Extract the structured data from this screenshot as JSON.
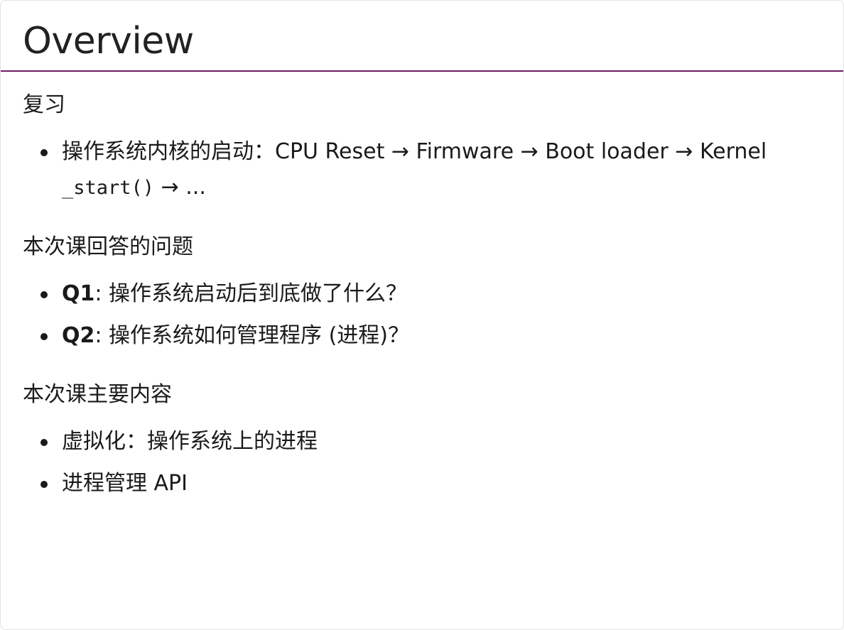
{
  "slide": {
    "title": "Overview",
    "sections": [
      {
        "heading": "复习",
        "items": [
          {
            "text_1": "操作系统内核的启动：CPU Reset → Firmware → Boot loader → Kernel ",
            "code": "_start()",
            "text_2": " → ..."
          }
        ]
      },
      {
        "heading": "本次课回答的问题",
        "items": [
          {
            "label": "Q1",
            "text": ": 操作系统启动后到底做了什么？"
          },
          {
            "label": "Q2",
            "text": ": 操作系统如何管理程序 (进程)？"
          }
        ]
      },
      {
        "heading": "本次课主要内容",
        "items": [
          {
            "text": "虚拟化：操作系统上的进程"
          },
          {
            "text": "进程管理 API"
          }
        ]
      }
    ]
  },
  "colors": {
    "accent_rule": "#6b1d63",
    "text": "#1a1a1a",
    "background": "#ffffff"
  }
}
